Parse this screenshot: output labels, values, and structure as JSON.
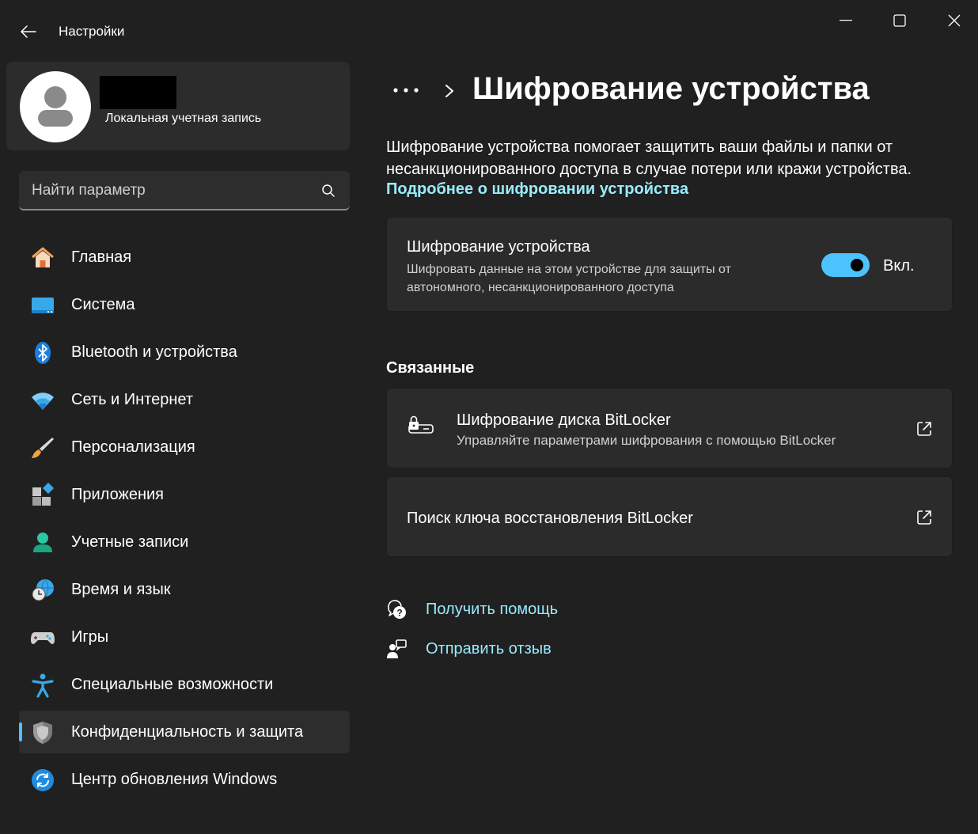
{
  "window": {
    "title": "Настройки",
    "controls": [
      "minimize",
      "maximize",
      "close"
    ]
  },
  "profile": {
    "account_type": "Локальная учетная запись"
  },
  "search": {
    "placeholder": "Найти параметр"
  },
  "sidebar": {
    "items": [
      {
        "label": "Главная",
        "icon": "home-icon"
      },
      {
        "label": "Система",
        "icon": "display-icon"
      },
      {
        "label": "Bluetooth и устройства",
        "icon": "bluetooth-icon"
      },
      {
        "label": "Сеть и Интернет",
        "icon": "wifi-icon"
      },
      {
        "label": "Персонализация",
        "icon": "brush-icon"
      },
      {
        "label": "Приложения",
        "icon": "apps-icon"
      },
      {
        "label": "Учетные записи",
        "icon": "person-icon"
      },
      {
        "label": "Время и язык",
        "icon": "clock-globe-icon"
      },
      {
        "label": "Игры",
        "icon": "gamepad-icon"
      },
      {
        "label": "Специальные возможности",
        "icon": "accessibility-icon"
      },
      {
        "label": "Конфиденциальность и защита",
        "icon": "shield-icon",
        "active": true
      },
      {
        "label": "Центр обновления Windows",
        "icon": "update-icon"
      }
    ]
  },
  "main": {
    "breadcrumb_more": "•••",
    "page_title": "Шифрование устройства",
    "description": "Шифрование устройства помогает защитить ваши файлы и папки от несанкционированного доступа в случае потери или кражи устройства.",
    "learn_more_link": "Подробнее о шифровании устройства",
    "encryption_card": {
      "title": "Шифрование устройства",
      "subtitle": "Шифровать данные на этом устройстве для защиты от автономного, несанкционированного доступа",
      "toggle_state": "Вкл.",
      "toggle_on": true
    },
    "related": {
      "title": "Связанные",
      "items": [
        {
          "title": "Шифрование диска BitLocker",
          "subtitle": "Управляйте параметрами шифрования с помощью BitLocker"
        },
        {
          "title": "Поиск ключа восстановления BitLocker"
        }
      ]
    },
    "help": {
      "get_help": "Получить помощь",
      "feedback": "Отправить отзыв"
    }
  },
  "colors": {
    "background": "#202020",
    "card": "#2b2b2b",
    "accent": "#4cc2ff",
    "link": "#99ebff"
  }
}
